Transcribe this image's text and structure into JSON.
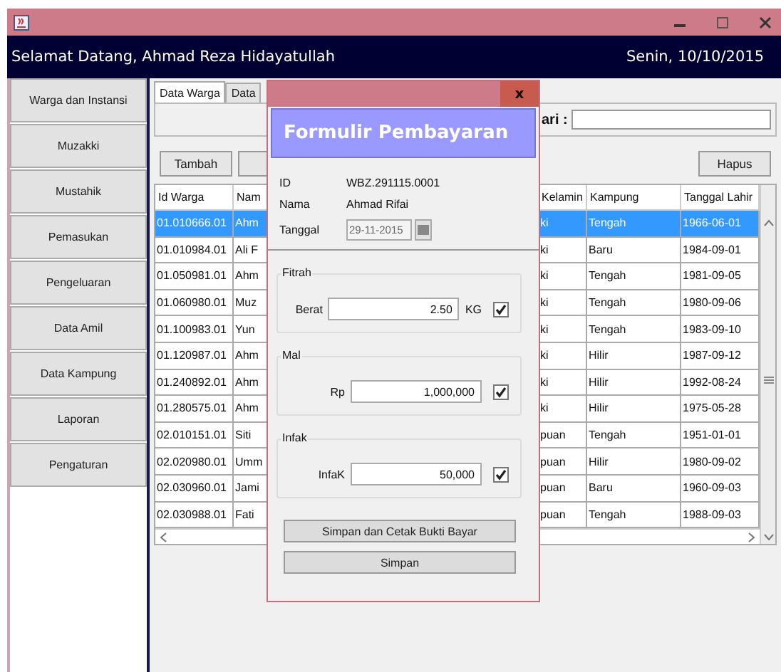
{
  "header": {
    "greeting": "Selamat Datang, Ahmad Reza Hidayatullah",
    "date": "Senin, 10/10/2015"
  },
  "sidebar": {
    "items": [
      "Warga dan Instansi",
      "Muzakki",
      "Mustahik",
      "Pemasukan",
      "Pengeluaran",
      "Data Amil",
      "Data Kampung",
      "Laporan",
      "Pengaturan"
    ]
  },
  "tabs": [
    {
      "label": "Data Warga",
      "selected": true
    },
    {
      "label": "Data",
      "selected": false
    }
  ],
  "search": {
    "label": "ari :"
  },
  "toolbar": {
    "add_button": "Tambah",
    "delete_button": "Hapus"
  },
  "table": {
    "columns": [
      "Id Warga",
      "Nam",
      "Kelamin",
      "Kampung",
      "Tanggal Lahir"
    ],
    "rows": [
      {
        "selected": true,
        "cells": [
          "01.010666.01",
          "Ahm",
          "ki",
          "Tengah",
          "1966-06-01"
        ]
      },
      {
        "selected": false,
        "cells": [
          "01.010984.01",
          "Ali F",
          "ki",
          "Baru",
          "1984-09-01"
        ]
      },
      {
        "selected": false,
        "cells": [
          "01.050981.01",
          "Ahm",
          "ki",
          "Tengah",
          "1981-09-05"
        ]
      },
      {
        "selected": false,
        "cells": [
          "01.060980.01",
          "Muz",
          "ki",
          "Tengah",
          "1980-09-06"
        ]
      },
      {
        "selected": false,
        "cells": [
          "01.100983.01",
          "Yun",
          "ki",
          "Tengah",
          "1983-09-10"
        ]
      },
      {
        "selected": false,
        "cells": [
          "01.120987.01",
          "Ahm",
          "ki",
          "Hilir",
          "1987-09-12"
        ]
      },
      {
        "selected": false,
        "cells": [
          "01.240892.01",
          "Ahm",
          "ki",
          "Hilir",
          "1992-08-24"
        ]
      },
      {
        "selected": false,
        "cells": [
          "01.280575.01",
          "Ahm",
          "ki",
          "Hilir",
          "1975-05-28"
        ]
      },
      {
        "selected": false,
        "cells": [
          "02.010151.01",
          "Siti",
          "puan",
          "Tengah",
          "1951-01-01"
        ]
      },
      {
        "selected": false,
        "cells": [
          "02.020980.01",
          "Umm",
          "puan",
          "Hilir",
          "1980-09-02"
        ]
      },
      {
        "selected": false,
        "cells": [
          "02.030960.01",
          "Jami",
          "puan",
          "Baru",
          "1960-09-03"
        ]
      },
      {
        "selected": false,
        "cells": [
          "02.030988.01",
          "Fati",
          "puan",
          "Tengah",
          "1988-09-03"
        ]
      }
    ]
  },
  "dialog": {
    "close": "x",
    "title": "Formulir Pembayaran",
    "info": [
      {
        "label": "ID",
        "value": "WBZ.291115.0001"
      },
      {
        "label": "Nama",
        "value": "Ahmad Rifai"
      }
    ],
    "date": {
      "label": "Tanggal",
      "value": "29-11-2015",
      "disabled": true
    },
    "groups": [
      {
        "legend": "Fitrah",
        "label": "Berat",
        "value": "2.50",
        "unit": "KG",
        "checked": true
      },
      {
        "legend": "Mal",
        "label": "Rp",
        "value": "1,000,000",
        "checked": true
      },
      {
        "legend": "Infak",
        "label": "InfaK",
        "value": "50,000",
        "checked": true
      }
    ],
    "buttons": [
      "Simpan dan Cetak Bukti Bayar",
      "Simpan"
    ]
  }
}
